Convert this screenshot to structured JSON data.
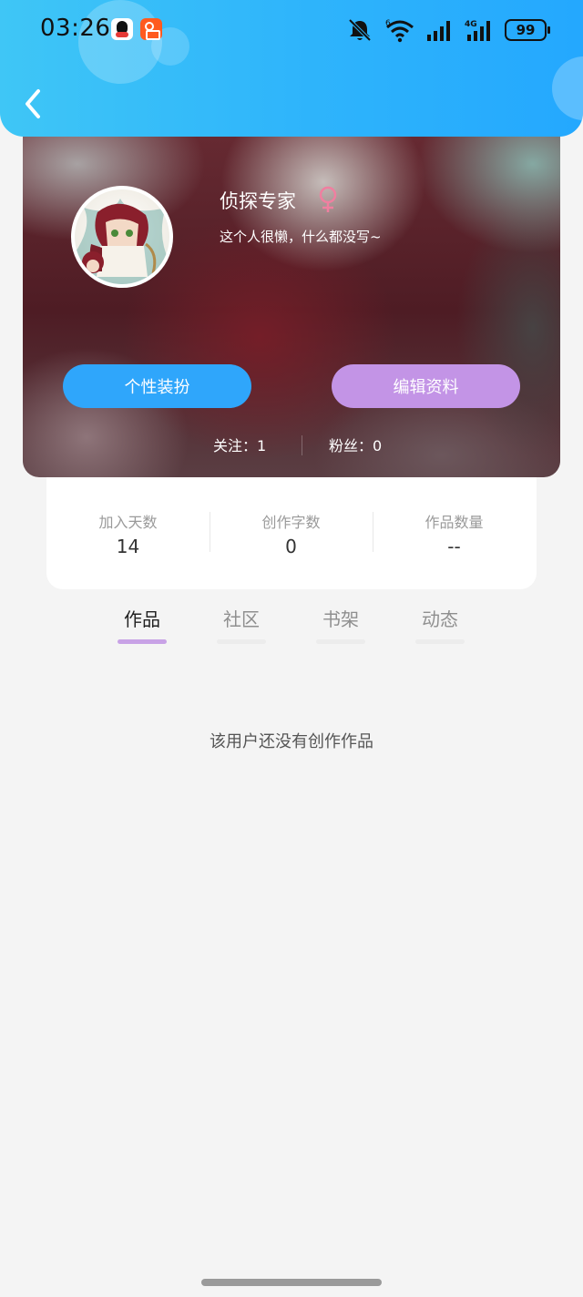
{
  "status_bar": {
    "time": "03:26",
    "battery": "99",
    "icons": [
      "qq-icon",
      "kuaishou-icon",
      "bell-off-icon",
      "wifi-6-icon",
      "signal-icon",
      "signal-4g-icon",
      "battery-icon"
    ]
  },
  "header": {
    "back_icon": "chevron-left-icon",
    "accent_color": "#2fb5fb"
  },
  "profile": {
    "name": "侦探专家",
    "gender_icon": "female-icon",
    "gender_color": "#f07fa0",
    "bio": "这个人很懒，什么都没写~",
    "buttons": {
      "dress_up": "个性装扮",
      "edit_profile": "编辑资料"
    },
    "follow_label": "关注：1",
    "fans_label": "粉丝：0"
  },
  "stats": [
    {
      "label": "加入天数",
      "value": "14"
    },
    {
      "label": "创作字数",
      "value": "0"
    },
    {
      "label": "作品数量",
      "value": "--"
    }
  ],
  "tabs": [
    {
      "label": "作品",
      "active": true
    },
    {
      "label": "社区",
      "active": false
    },
    {
      "label": "书架",
      "active": false
    },
    {
      "label": "动态",
      "active": false
    }
  ],
  "empty_message": "该用户还没有创作作品"
}
